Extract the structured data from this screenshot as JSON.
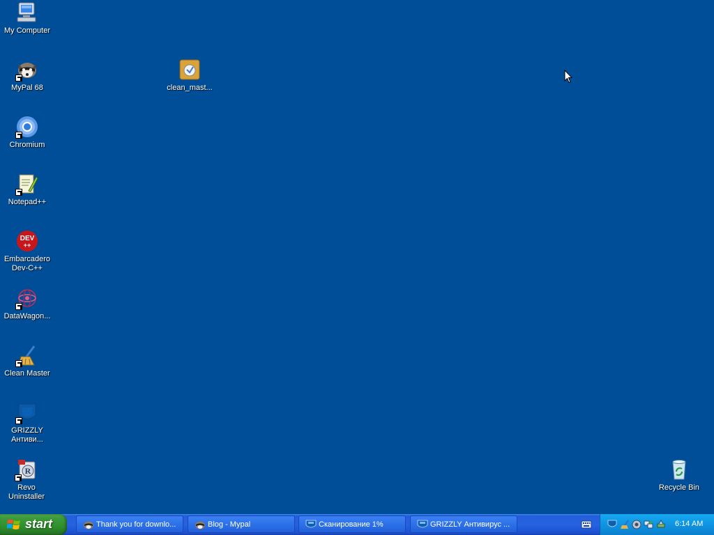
{
  "desktop": {
    "background_color": "#004e98",
    "icons": {
      "my_computer": {
        "label": "My Computer",
        "icon": "my-computer-icon"
      },
      "mypal": {
        "label": "MyPal 68",
        "icon": "mypal-raccoon-icon"
      },
      "chromium": {
        "label": "Chromium",
        "icon": "chromium-icon"
      },
      "notepadpp": {
        "label": "Notepad++",
        "icon": "notepadpp-icon"
      },
      "devcpp": {
        "label": "Embarcadero Dev-C++",
        "icon": "devcpp-icon",
        "badge": "DEV ++"
      },
      "datawagon": {
        "label": "DataWagon...",
        "icon": "datawagon-icon"
      },
      "clean_master": {
        "label": "Clean Master",
        "icon": "clean-master-broom-icon"
      },
      "grizzly": {
        "label": "GRIZZLY Антиви...",
        "icon": "grizzly-icon"
      },
      "revo": {
        "label": "Revo Uninstaller",
        "icon": "revo-uninstaller-icon"
      },
      "clean_master_setup": {
        "label": "clean_mast...",
        "icon": "installer-package-icon"
      },
      "recycle_bin": {
        "label": "Recycle Bin",
        "icon": "recycle-bin-icon"
      }
    }
  },
  "taskbar": {
    "start_label": "start",
    "tasks": [
      {
        "label": "Thank you for downlo...",
        "icon": "mypal-raccoon-icon"
      },
      {
        "label": "Blog - Mypal",
        "icon": "mypal-raccoon-icon"
      },
      {
        "label": "Сканирование 1%",
        "icon": "grizzly-icon"
      },
      {
        "label": "GRIZZLY Антивирус ...",
        "icon": "grizzly-icon"
      }
    ],
    "tray": {
      "clock": "6:14 AM",
      "icons": [
        "grizzly-tray-icon",
        "clean-master-tray-icon",
        "volume-tray-icon",
        "network-tray-icon",
        "safely-remove-tray-icon"
      ]
    }
  }
}
